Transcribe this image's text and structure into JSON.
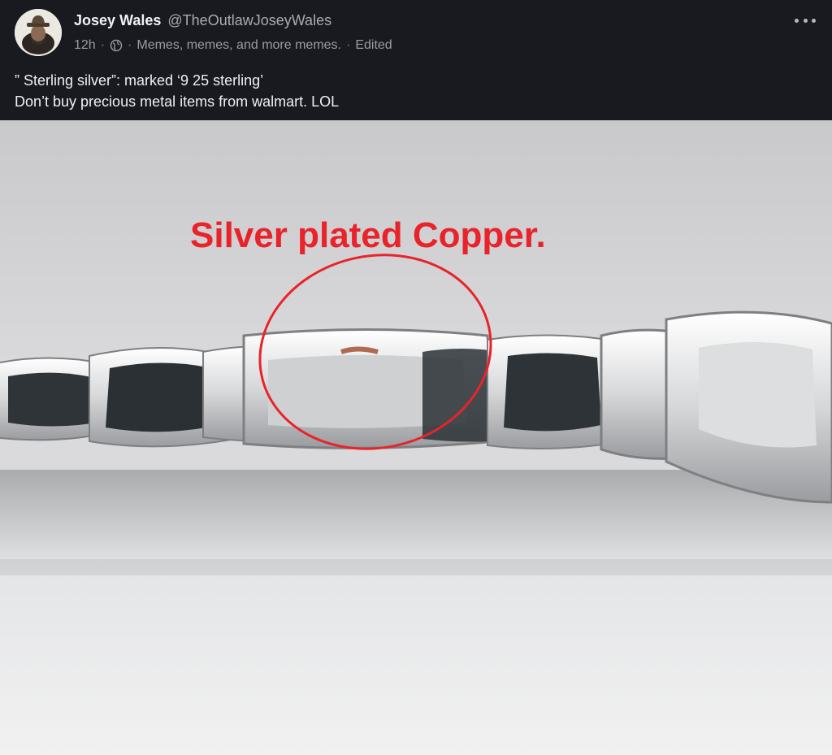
{
  "post": {
    "author": {
      "name": "Josey Wales",
      "handle": "@TheOutlawJoseyWales",
      "avatar_icon": "cowboy-avatar"
    },
    "meta": {
      "time": "12h",
      "dot": "·",
      "visibility_icon": "globe-icon",
      "community": "Memes, memes, and more memes.",
      "edited": "Edited"
    },
    "more_icon": "ellipsis-icon",
    "text": {
      "line1": "” Sterling silver”: marked ‘9 25 sterling’",
      "line2": "Don’t buy precious metal items from walmart. LOL"
    },
    "image": {
      "caption": "Silver plated Copper.",
      "annotation_color": "#e8242a"
    }
  },
  "colors": {
    "background": "#181a20",
    "text_primary": "#f0f0f2",
    "text_secondary": "#9a9ca4",
    "annotation": "#e8242a"
  }
}
